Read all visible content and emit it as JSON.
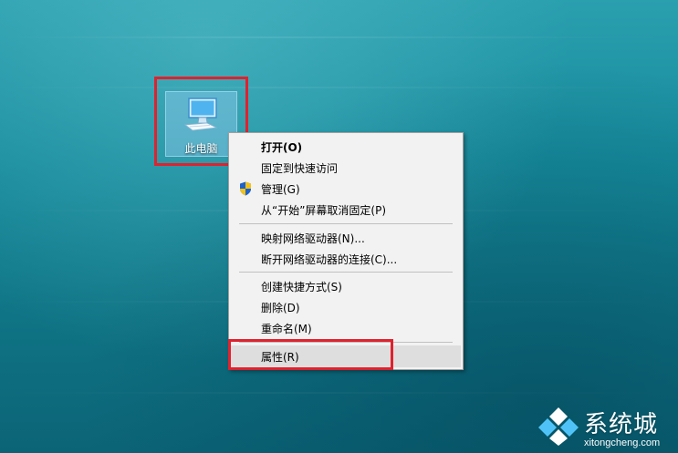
{
  "desktop": {
    "icon_label": "此电脑"
  },
  "context_menu": {
    "items": [
      {
        "label": "打开(O)"
      },
      {
        "label": "固定到快速访问"
      },
      {
        "label": "管理(G)",
        "icon": "uac-shield-icon"
      },
      {
        "label": "从“开始”屏幕取消固定(P)"
      },
      {
        "label": "映射网络驱动器(N)..."
      },
      {
        "label": "断开网络驱动器的连接(C)..."
      },
      {
        "label": "创建快捷方式(S)"
      },
      {
        "label": "删除(D)"
      },
      {
        "label": "重命名(M)"
      },
      {
        "label": "属性(R)"
      }
    ],
    "highlighted_item": "属性(R)"
  },
  "watermark": {
    "title": "系统城",
    "subtitle": "xitongcheng.com"
  },
  "colors": {
    "highlight_box": "#e0212e",
    "menu_background": "#f2f2f2",
    "menu_hover": "#dedede",
    "desktop_teal": "#168b9c"
  }
}
